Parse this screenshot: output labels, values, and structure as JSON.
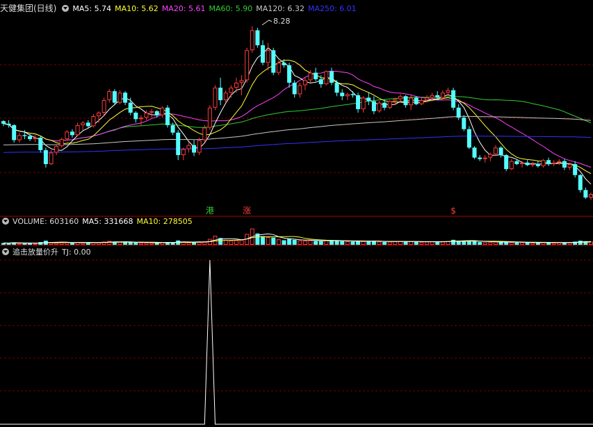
{
  "colors": {
    "up": "#ff3c3c",
    "down": "#54ffff",
    "ma5": "#ffffff",
    "ma10": "#ffff33",
    "ma20": "#ff44ff",
    "ma60": "#33cc33",
    "ma120": "#c8c8c8",
    "ma250": "#3333ff",
    "grid": "#7a0000",
    "signal": "#ffffff"
  },
  "header": {
    "stock_title": "天健集团(日线)",
    "ma5": "MA5: 5.74",
    "ma10": "MA10: 5.62",
    "ma20": "MA20: 5.61",
    "ma60": "MA60: 5.90",
    "ma120": "MA120: 6.32",
    "ma250": "MA250: 6.01"
  },
  "volume_header": {
    "volume": "VOLUME: 603160",
    "ma5": "MA5: 331668",
    "ma10": "MA10: 278505"
  },
  "indicator_header": {
    "name": "追击放量价升",
    "value": "TJ: 0.00"
  },
  "chart_data": [
    {
      "type": "candlestick",
      "ylim": [
        4.6,
        8.5
      ],
      "high_label": "8.28",
      "marks": [
        {
          "text": "港",
          "bar": 39,
          "color": "#33cc33"
        },
        {
          "text": "涨",
          "bar": 46,
          "color": "#ff3c3c"
        },
        {
          "text": "$",
          "bar": 85,
          "color": "#ff3c3c"
        }
      ],
      "ohlc": [
        [
          6.38,
          6.4,
          6.28,
          6.33
        ],
        [
          6.33,
          6.4,
          6.25,
          6.3
        ],
        [
          6.3,
          6.32,
          5.95,
          6.0
        ],
        [
          6.0,
          6.15,
          5.95,
          6.1
        ],
        [
          6.1,
          6.2,
          6.02,
          6.08
        ],
        [
          6.08,
          6.12,
          5.98,
          6.02
        ],
        [
          6.02,
          6.1,
          5.96,
          6.05
        ],
        [
          6.05,
          6.08,
          5.75,
          5.8
        ],
        [
          5.8,
          5.85,
          5.45,
          5.52
        ],
        [
          5.52,
          5.8,
          5.5,
          5.75
        ],
        [
          5.75,
          5.92,
          5.7,
          5.88
        ],
        [
          5.88,
          6.05,
          5.85,
          6.02
        ],
        [
          6.02,
          6.2,
          6.0,
          6.17
        ],
        [
          6.17,
          6.22,
          6.05,
          6.1
        ],
        [
          6.1,
          6.35,
          6.08,
          6.3
        ],
        [
          6.3,
          6.38,
          6.2,
          6.35
        ],
        [
          6.35,
          6.4,
          6.25,
          6.28
        ],
        [
          6.28,
          6.52,
          6.25,
          6.48
        ],
        [
          6.48,
          6.58,
          6.35,
          6.55
        ],
        [
          6.55,
          6.85,
          6.5,
          6.8
        ],
        [
          6.8,
          7.02,
          6.75,
          6.98
        ],
        [
          6.98,
          7.02,
          6.7,
          6.75
        ],
        [
          6.75,
          7.0,
          6.72,
          6.95
        ],
        [
          6.95,
          6.98,
          6.7,
          6.75
        ],
        [
          6.75,
          6.85,
          6.5,
          6.55
        ],
        [
          6.55,
          6.58,
          6.35,
          6.42
        ],
        [
          6.42,
          6.5,
          6.3,
          6.45
        ],
        [
          6.45,
          6.6,
          6.4,
          6.55
        ],
        [
          6.55,
          6.62,
          6.45,
          6.58
        ],
        [
          6.58,
          6.6,
          6.45,
          6.5
        ],
        [
          6.5,
          6.68,
          6.45,
          6.65
        ],
        [
          6.65,
          6.7,
          6.25,
          6.3
        ],
        [
          6.3,
          6.35,
          6.1,
          6.15
        ],
        [
          6.15,
          6.2,
          5.6,
          5.7
        ],
        [
          5.7,
          5.85,
          5.6,
          5.82
        ],
        [
          5.82,
          5.95,
          5.75,
          5.9
        ],
        [
          5.9,
          6.0,
          5.68,
          5.75
        ],
        [
          5.75,
          6.05,
          5.7,
          6.0
        ],
        [
          6.0,
          6.3,
          5.95,
          6.25
        ],
        [
          6.25,
          6.7,
          6.2,
          6.65
        ],
        [
          6.65,
          7.1,
          6.6,
          7.05
        ],
        [
          7.05,
          7.25,
          6.7,
          6.8
        ],
        [
          6.8,
          7.0,
          6.75,
          6.95
        ],
        [
          6.95,
          7.1,
          6.85,
          7.05
        ],
        [
          7.05,
          7.25,
          6.95,
          7.15
        ],
        [
          7.15,
          7.3,
          6.9,
          7.2
        ],
        [
          7.2,
          7.85,
          7.15,
          7.8
        ],
        [
          7.8,
          8.28,
          7.75,
          8.2
        ],
        [
          8.2,
          8.25,
          7.85,
          7.9
        ],
        [
          7.9,
          8.0,
          7.5,
          7.55
        ],
        [
          7.55,
          7.95,
          7.4,
          7.8
        ],
        [
          7.8,
          7.85,
          7.3,
          7.35
        ],
        [
          7.35,
          7.6,
          7.3,
          7.55
        ],
        [
          7.55,
          7.62,
          7.45,
          7.5
        ],
        [
          7.5,
          7.55,
          7.05,
          7.15
        ],
        [
          7.15,
          7.2,
          6.85,
          6.92
        ],
        [
          6.92,
          7.15,
          6.85,
          7.1
        ],
        [
          7.1,
          7.25,
          7.0,
          7.2
        ],
        [
          7.2,
          7.4,
          7.15,
          7.35
        ],
        [
          7.35,
          7.45,
          7.18,
          7.22
        ],
        [
          7.22,
          7.3,
          7.05,
          7.12
        ],
        [
          7.12,
          7.4,
          7.1,
          7.38
        ],
        [
          7.38,
          7.45,
          7.1,
          7.15
        ],
        [
          7.15,
          7.2,
          6.88,
          6.95
        ],
        [
          6.95,
          7.02,
          6.8,
          6.88
        ],
        [
          6.88,
          6.95,
          6.8,
          6.92
        ],
        [
          6.92,
          6.98,
          6.85,
          6.9
        ],
        [
          6.9,
          6.95,
          6.55,
          6.62
        ],
        [
          6.62,
          6.88,
          6.55,
          6.85
        ],
        [
          6.85,
          6.95,
          6.7,
          6.78
        ],
        [
          6.78,
          6.88,
          6.52,
          6.58
        ],
        [
          6.58,
          6.78,
          6.55,
          6.75
        ],
        [
          6.75,
          6.82,
          6.6,
          6.65
        ],
        [
          6.65,
          6.8,
          6.62,
          6.78
        ],
        [
          6.78,
          6.85,
          6.7,
          6.82
        ],
        [
          6.82,
          6.92,
          6.75,
          6.88
        ],
        [
          6.88,
          6.9,
          6.65,
          6.7
        ],
        [
          6.7,
          6.9,
          6.6,
          6.85
        ],
        [
          6.85,
          6.88,
          6.7,
          6.72
        ],
        [
          6.72,
          6.85,
          6.7,
          6.8
        ],
        [
          6.8,
          6.9,
          6.75,
          6.85
        ],
        [
          6.85,
          6.95,
          6.78,
          6.9
        ],
        [
          6.9,
          6.98,
          6.8,
          6.85
        ],
        [
          6.85,
          7.0,
          6.8,
          6.95
        ],
        [
          6.95,
          7.05,
          6.88,
          7.0
        ],
        [
          7.0,
          7.05,
          6.6,
          6.65
        ],
        [
          6.65,
          6.72,
          6.4,
          6.45
        ],
        [
          6.45,
          6.5,
          6.18,
          6.22
        ],
        [
          6.22,
          6.28,
          5.82,
          5.85
        ],
        [
          5.85,
          5.88,
          5.62,
          5.65
        ],
        [
          5.65,
          5.7,
          5.58,
          5.62
        ],
        [
          5.62,
          5.7,
          5.55,
          5.65
        ],
        [
          5.65,
          5.75,
          5.58,
          5.72
        ],
        [
          5.72,
          5.9,
          5.68,
          5.85
        ],
        [
          5.85,
          5.88,
          5.65,
          5.7
        ],
        [
          5.7,
          5.72,
          5.38,
          5.42
        ],
        [
          5.42,
          5.62,
          5.4,
          5.58
        ],
        [
          5.58,
          5.62,
          5.5,
          5.52
        ],
        [
          5.52,
          5.58,
          5.45,
          5.55
        ],
        [
          5.55,
          5.6,
          5.48,
          5.5
        ],
        [
          5.5,
          5.56,
          5.46,
          5.52
        ],
        [
          5.52,
          5.58,
          5.45,
          5.48
        ],
        [
          5.48,
          5.62,
          5.45,
          5.6
        ],
        [
          5.6,
          5.65,
          5.48,
          5.52
        ],
        [
          5.52,
          5.6,
          5.48,
          5.55
        ],
        [
          5.55,
          5.62,
          5.5,
          5.58
        ],
        [
          5.58,
          5.62,
          5.4,
          5.45
        ],
        [
          5.45,
          5.55,
          5.4,
          5.52
        ],
        [
          5.52,
          5.58,
          5.25,
          5.3
        ],
        [
          5.3,
          5.32,
          4.95,
          5.0
        ],
        [
          5.0,
          5.05,
          4.82,
          4.85
        ],
        [
          4.85,
          4.95,
          4.8,
          4.92
        ]
      ]
    },
    {
      "type": "bar",
      "title": "VOLUME",
      "ylim": [
        0,
        400000
      ],
      "values": [
        40000,
        38000,
        55000,
        36000,
        32000,
        35000,
        30000,
        60000,
        90000,
        50000,
        45000,
        52000,
        55000,
        40000,
        60000,
        45000,
        38000,
        55000,
        50000,
        70000,
        85000,
        60000,
        65000,
        55000,
        60000,
        50000,
        45000,
        48000,
        42000,
        40000,
        55000,
        60000,
        50000,
        95000,
        60000,
        50000,
        55000,
        60000,
        80000,
        130000,
        200000,
        150000,
        110000,
        90000,
        100000,
        110000,
        240000,
        360000,
        250000,
        190000,
        170000,
        160000,
        120000,
        100000,
        130000,
        110000,
        95000,
        90000,
        100000,
        85000,
        80000,
        100000,
        95000,
        85000,
        80000,
        75000,
        70000,
        90000,
        80000,
        75000,
        85000,
        70000,
        65000,
        70000,
        75000,
        80000,
        70000,
        75000,
        65000,
        60000,
        70000,
        75000,
        65000,
        70000,
        80000,
        110000,
        90000,
        85000,
        95000,
        80000,
        60000,
        55000,
        60000,
        70000,
        60000,
        65000,
        55000,
        50000,
        55000,
        50000,
        45000,
        50000,
        55000,
        50000,
        45000,
        50000,
        55000,
        50000,
        70000,
        90000,
        80000,
        70000
      ]
    },
    {
      "type": "line",
      "title": "追击放量价升",
      "ylim": [
        0,
        1
      ],
      "spike_at_bar": 39,
      "spike_value": 1
    }
  ]
}
